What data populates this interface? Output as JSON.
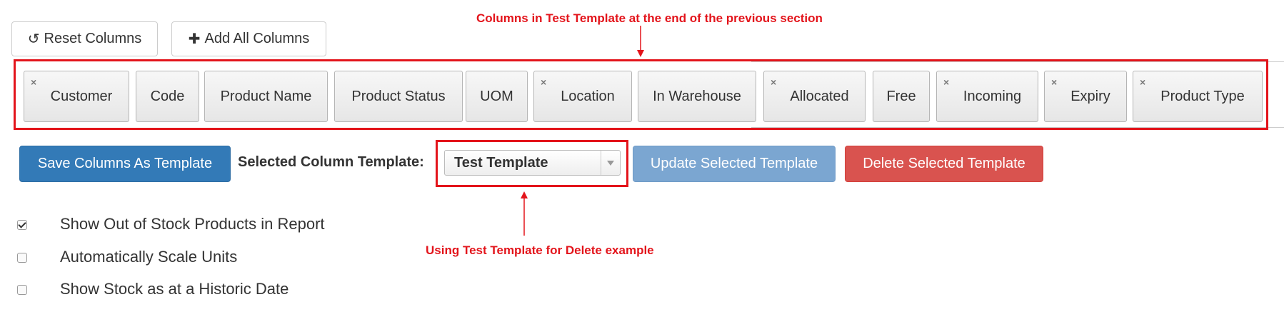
{
  "toolbar": {
    "reset_label": "Reset Columns",
    "add_all_label": "Add All Columns",
    "reset_icon": "undo-icon",
    "add_icon": "plus-icon"
  },
  "columns": [
    {
      "label": "Customer",
      "removable": true
    },
    {
      "label": "Code",
      "removable": false
    },
    {
      "label": "Product Name",
      "removable": false
    },
    {
      "label": "Product Status",
      "removable": false
    },
    {
      "label": "UOM",
      "removable": false
    },
    {
      "label": "Location",
      "removable": true
    },
    {
      "label": "In Warehouse",
      "removable": false
    },
    {
      "label": "Allocated",
      "removable": true
    },
    {
      "label": "Free",
      "removable": false
    },
    {
      "label": "Incoming",
      "removable": true
    },
    {
      "label": "Expiry",
      "removable": true
    },
    {
      "label": "Product Type",
      "removable": true
    }
  ],
  "remove_glyph": "×",
  "template": {
    "save_label": "Save Columns As Template",
    "selected_label": "Selected Column Template:",
    "selected_value": "Test Template",
    "update_label": "Update Selected Template",
    "delete_label": "Delete Selected Template"
  },
  "options": [
    {
      "label": "Show Out of Stock Products in Report",
      "checked": true
    },
    {
      "label": "Automatically Scale Units",
      "checked": false
    },
    {
      "label": "Show Stock as at a Historic Date",
      "checked": false
    }
  ],
  "annotations": {
    "top": "Columns in Test Template at the end of the previous section",
    "middle": "Using Test Template for Delete example"
  },
  "colors": {
    "annotation_red": "#e3141b",
    "primary": "#337ab7",
    "danger": "#d9534f",
    "info_disabled": "#7ba6d1"
  }
}
